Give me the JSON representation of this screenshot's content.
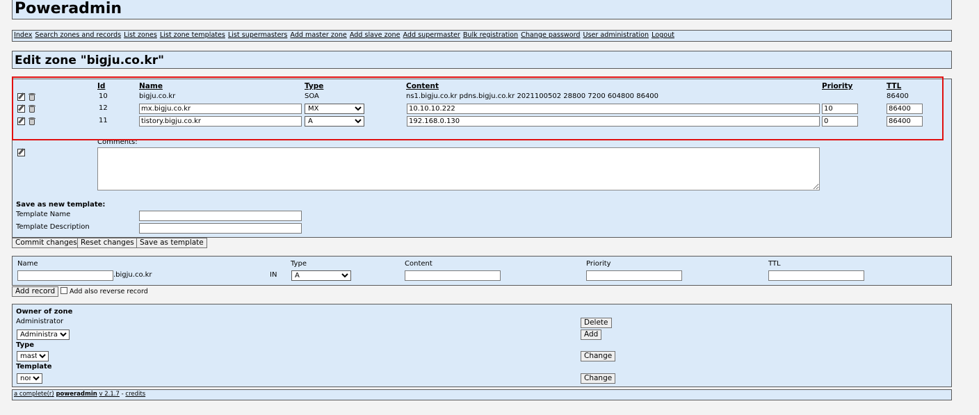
{
  "app_title": "Poweradmin",
  "menu": [
    "Index",
    "Search zones and records",
    "List zones",
    "List zone templates",
    "List supermasters",
    "Add master zone",
    "Add slave zone",
    "Add supermaster",
    "Bulk registration",
    "Change password",
    "User administration",
    "Logout"
  ],
  "zone_header": "Edit zone \"bigju.co.kr\"",
  "records_table": {
    "headers": {
      "id": "Id",
      "name": "Name",
      "type": "Type",
      "content": "Content",
      "priority": "Priority",
      "ttl": "TTL"
    },
    "rows": [
      {
        "id": "10",
        "name": "bigju.co.kr",
        "type": "SOA",
        "content": "ns1.bigju.co.kr pdns.bigju.co.kr 2021100502 28800 7200 604800 86400",
        "priority": "",
        "ttl": "86400"
      },
      {
        "id": "12",
        "name": "mx.bigju.co.kr",
        "type": "MX",
        "content": "10.10.10.222",
        "priority": "10",
        "ttl": "86400"
      },
      {
        "id": "11",
        "name": "tistory.bigju.co.kr",
        "type": "A",
        "content": "192.168.0.130",
        "priority": "0",
        "ttl": "86400"
      }
    ]
  },
  "comments_label": "Comments:",
  "template_section": {
    "title": "Save as new template:",
    "name_label": "Template Name",
    "desc_label": "Template Description"
  },
  "buttons": {
    "commit": "Commit changes",
    "reset": "Reset changes",
    "save_template": "Save as template",
    "add_record": "Add record",
    "delete": "Delete",
    "add": "Add",
    "change_type": "Change",
    "change_template": "Change"
  },
  "add_record": {
    "name_label": "Name",
    "type_label": "Type",
    "content_label": "Content",
    "priority_label": "Priority",
    "ttl_label": "TTL",
    "suffix": ".bigju.co.kr",
    "class": "IN",
    "type_value": "A",
    "reverse_label": "Add also reverse record"
  },
  "owner_section": {
    "owner_title": "Owner of zone",
    "owner_name": "Administrator",
    "owner_select": "Administrator",
    "type_title": "Type",
    "type_value": "master",
    "template_title": "Template",
    "template_value": "none"
  },
  "footer": {
    "prefix": "a complete(r)",
    "app": "poweradmin",
    "version": "v 2.1.7",
    "sep": "-",
    "credits": "credits"
  }
}
